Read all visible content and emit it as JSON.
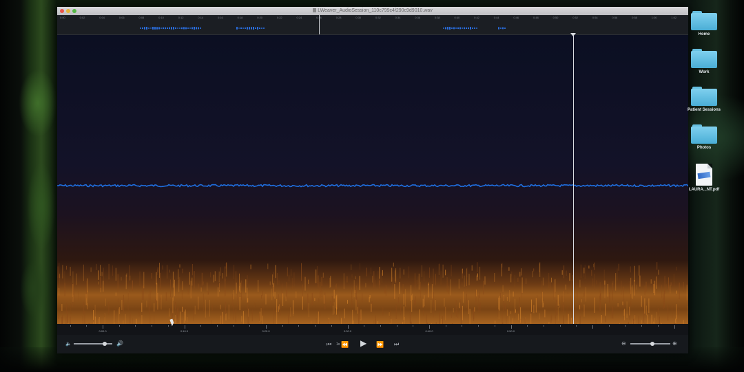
{
  "window": {
    "title": "LWeaver_AudioSession_110c799c4f290c9d9010.wav"
  },
  "overview": {
    "ruler_labels": [
      "0:00",
      "0:02",
      "0:04",
      "0:06",
      "0:08",
      "0:10",
      "0:12",
      "0:14",
      "0:16",
      "0:18",
      "0:20",
      "0:22",
      "0:24",
      "0:26",
      "0:28",
      "0:30",
      "0:32",
      "0:34",
      "0:36",
      "0:38",
      "0:40",
      "0:42",
      "0:44",
      "0:46",
      "0:48",
      "0:50",
      "0:52",
      "0:54",
      "0:56",
      "0:58",
      "1:00",
      "1:02"
    ]
  },
  "timeline": {
    "labels": [
      "0:00.0",
      "0:10.0",
      "0:20.0",
      "0:30.0",
      "0:40.0",
      "0:50.0"
    ]
  },
  "controls": {
    "volume_level": 0.8,
    "skip_start_icon": "⏮",
    "speed_label": "1x",
    "rewind_icon": "⏪",
    "play_icon": "▶",
    "fast_forward_icon": "⏩",
    "skip_end_icon": "⏭",
    "zoom_level": 0.55
  },
  "desktop_icons": [
    {
      "label": "Home",
      "type": "folder"
    },
    {
      "label": "Work",
      "type": "folder"
    },
    {
      "label": "Patient Sessions",
      "type": "folder"
    },
    {
      "label": "Photos",
      "type": "folder"
    },
    {
      "label": "LAURA...NT.pdf",
      "type": "pdf"
    }
  ],
  "colors": {
    "waveform": "#1f6fe0",
    "spectrogram_low": "#1a1022",
    "spectrogram_high": "#e0902a",
    "folder": "#5fbfe3"
  }
}
